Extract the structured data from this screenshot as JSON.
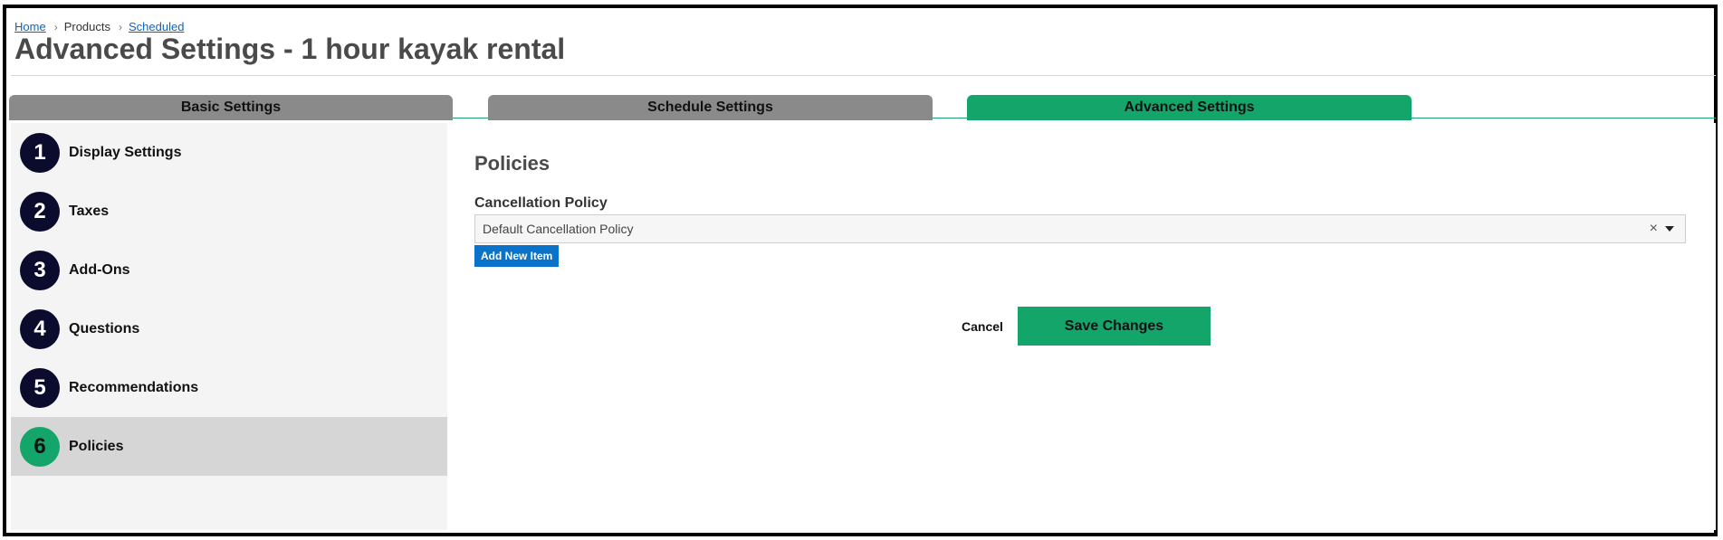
{
  "breadcrumb": {
    "home": "Home",
    "products": "Products",
    "scheduled": "Scheduled",
    "separator": "›"
  },
  "page_title": "Advanced Settings - 1 hour kayak rental",
  "tabs": [
    {
      "label": "Basic Settings",
      "active": false
    },
    {
      "label": "Schedule Settings",
      "active": false
    },
    {
      "label": "Advanced Settings",
      "active": true
    }
  ],
  "steps": [
    {
      "number": "1",
      "label": "Display Settings"
    },
    {
      "number": "2",
      "label": "Taxes"
    },
    {
      "number": "3",
      "label": "Add-Ons"
    },
    {
      "number": "4",
      "label": "Questions"
    },
    {
      "number": "5",
      "label": "Recommendations"
    },
    {
      "number": "6",
      "label": "Policies",
      "active": true
    }
  ],
  "policies": {
    "section_title": "Policies",
    "cancellation_label": "Cancellation Policy",
    "cancellation_value": "Default Cancellation Policy",
    "clear_symbol": "×",
    "add_new_item": "Add New Item"
  },
  "actions": {
    "cancel": "Cancel",
    "save": "Save Changes"
  },
  "colors": {
    "accent_green": "#14a56b",
    "tab_gray": "#8a8a8a",
    "link_blue": "#0a64c8",
    "step_navy": "#0b0b2e"
  }
}
